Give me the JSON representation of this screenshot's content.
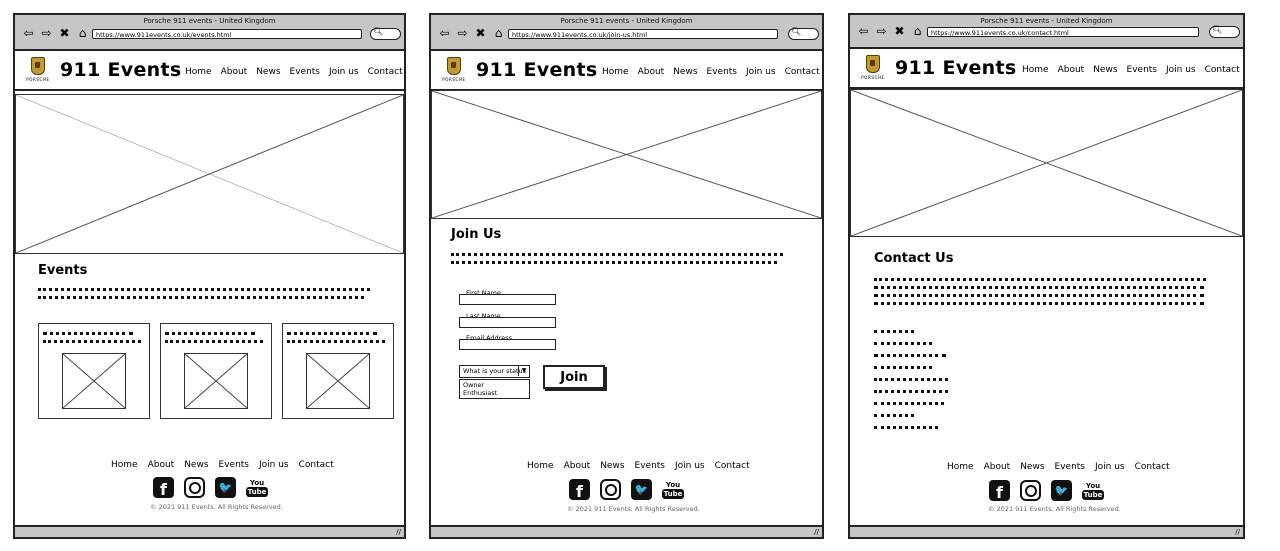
{
  "pages": [
    {
      "window_title": "Porsche 911 events - United Kingdom",
      "url": "https://www.911events.co.uk/events.html",
      "section_heading": "Events"
    },
    {
      "window_title": "Porsche 911 events - United Kingdom",
      "url": "https://www.911events.co.uk/join-us.html",
      "section_heading": "Join Us",
      "form": {
        "first_name_label": "First Name",
        "last_name_label": "Last Name",
        "email_label": "Email Address",
        "status_select_value": "What is your status",
        "status_options": [
          "Owner",
          "Enthusiast"
        ],
        "submit_label": "Join"
      }
    },
    {
      "window_title": "Porsche 911 events - United Kingdom",
      "url": "https://www.911events.co.uk/contact.html",
      "section_heading": "Contact Us"
    }
  ],
  "site": {
    "logo_word": "PORSCHE",
    "title": "911 Events",
    "menu": [
      "Home",
      "About",
      "News",
      "Events",
      "Join us",
      "Contact"
    ],
    "copyright": "© 2021 911 Events. All Rights Reserved."
  },
  "browser": {
    "nav_icons": [
      "back-icon",
      "forward-icon",
      "stop-icon",
      "home-icon"
    ],
    "search_icon": "search-icon"
  },
  "social": {
    "icons": [
      "facebook-icon",
      "instagram-icon",
      "twitter-icon",
      "youtube-icon"
    ],
    "facebook_glyph": "f",
    "twitter_glyph": "🐦",
    "youtube_top": "You",
    "youtube_bottom": "Tube"
  },
  "colors": {
    "chrome_gray": "#c6c6c6",
    "logo_gold": "#c39a2d"
  }
}
